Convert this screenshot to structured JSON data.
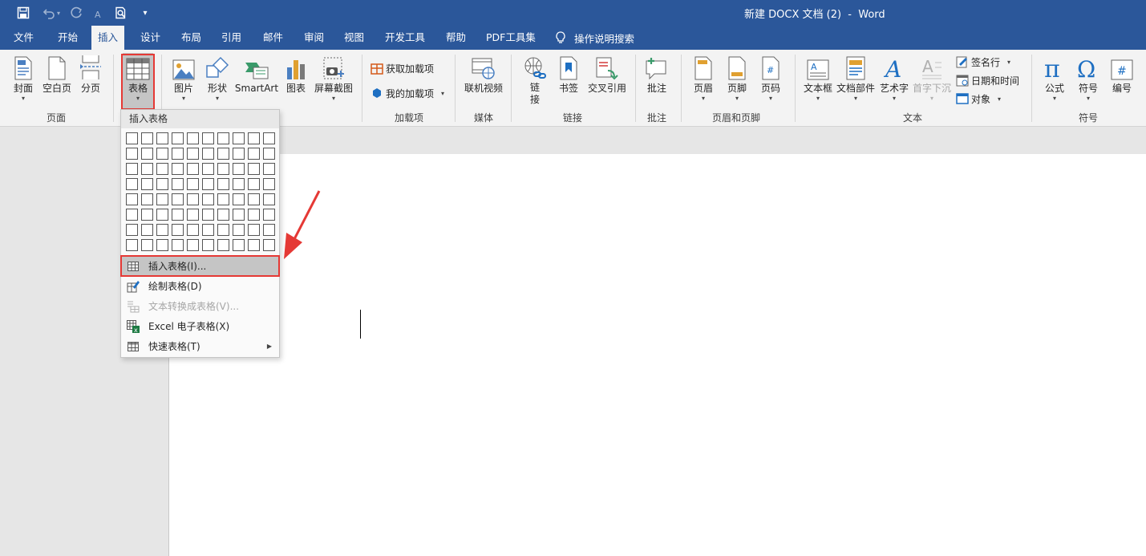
{
  "window": {
    "title": "新建 DOCX 文档 (2)  -  Word"
  },
  "tabs": [
    {
      "label": "文件"
    },
    {
      "label": "开始"
    },
    {
      "label": "插入"
    },
    {
      "label": "设计"
    },
    {
      "label": "布局"
    },
    {
      "label": "引用"
    },
    {
      "label": "邮件"
    },
    {
      "label": "审阅"
    },
    {
      "label": "视图"
    },
    {
      "label": "开发工具"
    },
    {
      "label": "帮助"
    },
    {
      "label": "PDF工具集"
    }
  ],
  "active_tab": "插入",
  "tell_me": "操作说明搜索",
  "ribbon": {
    "pages": {
      "cover": "封面",
      "blank": "空白页",
      "break": "分页",
      "group": "页面"
    },
    "table": {
      "label": "表格"
    },
    "illustrations": {
      "picture": "图片",
      "shapes": "形状",
      "smartart": "SmartArt",
      "chart": "图表",
      "screenshot": "屏幕截图"
    },
    "addins": {
      "get": "获取加载项",
      "my": "我的加载项",
      "group": "加载项"
    },
    "media": {
      "video": "联机视频",
      "group": "媒体"
    },
    "links": {
      "link": "链接",
      "bookmark": "书签",
      "crossref": "交叉引用",
      "group": "链接"
    },
    "comments": {
      "comment": "批注",
      "group": "批注"
    },
    "headerfooter": {
      "header": "页眉",
      "footer": "页脚",
      "pagenum": "页码",
      "group": "页眉和页脚"
    },
    "text": {
      "textbox": "文本框",
      "quickparts": "文档部件",
      "wordart": "艺术字",
      "dropcap": "首字下沉",
      "signature": "签名行",
      "datetime": "日期和时间",
      "object": "对象",
      "group": "文本"
    },
    "symbols": {
      "equation": "公式",
      "symbol": "符号",
      "number": "编号",
      "group": "符号"
    }
  },
  "dropdown": {
    "header": "插入表格",
    "grid": {
      "cols": 10,
      "rows": 8
    },
    "items": [
      {
        "label": "插入表格(I)...",
        "highlight": true,
        "disabled": false
      },
      {
        "label": "绘制表格(D)",
        "highlight": false,
        "disabled": false
      },
      {
        "label": "文本转换成表格(V)...",
        "highlight": false,
        "disabled": true
      },
      {
        "label": "Excel 电子表格(X)",
        "highlight": false,
        "disabled": false
      },
      {
        "label": "快速表格(T)",
        "highlight": false,
        "disabled": false,
        "submenu": true
      }
    ]
  },
  "colors": {
    "titlebar": "#2b579a",
    "ribbon": "#f3f3f3",
    "highlight_box": "#e53935"
  }
}
